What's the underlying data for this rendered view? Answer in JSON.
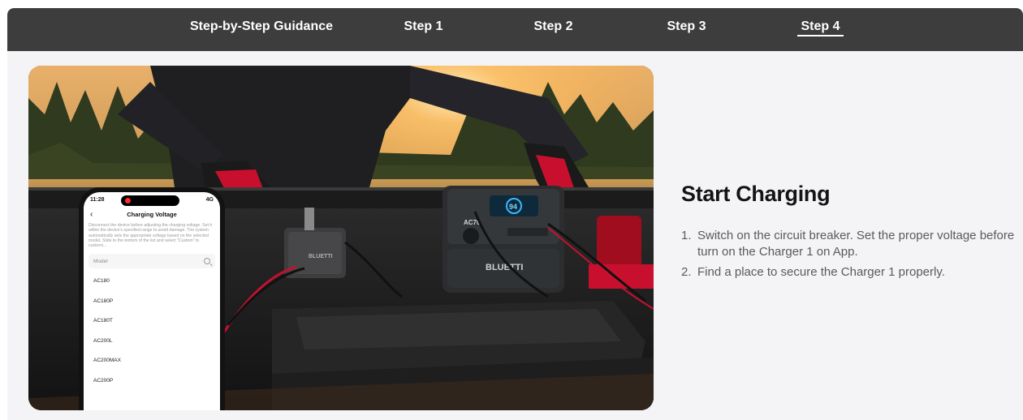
{
  "nav": {
    "items": [
      {
        "label": "Step-by-Step Guidance",
        "active": false
      },
      {
        "label": "Step 1",
        "active": false
      },
      {
        "label": "Step 2",
        "active": false
      },
      {
        "label": "Step 3",
        "active": false
      },
      {
        "label": "Step 4",
        "active": true
      }
    ]
  },
  "photo": {
    "brand_panel": "BLUETTI",
    "brand_station": "BLUETTI",
    "station_model": "AC70",
    "station_display": "94",
    "phone": {
      "time": "11:28",
      "network": "4G",
      "title": "Charging Voltage",
      "description": "Disconnect the device before adjusting the charging voltage. Set it within the device's specified range to avoid damage. The system automatically sets the appropriate voltage based on the selected model. Slide to the bottom of the list and select \"Custom\" to customi...",
      "search_placeholder": "Model",
      "models": [
        "AC180",
        "AC180P",
        "AC180T",
        "AC200L",
        "AC200MAX",
        "AC200P"
      ]
    }
  },
  "content": {
    "title": "Start Charging",
    "steps": [
      {
        "num": "1.",
        "text": "Switch on the circuit breaker. Set the proper voltage before turn on the Charger 1 on App."
      },
      {
        "num": "2.",
        "text": "Find a place to secure the Charger 1 properly."
      }
    ]
  },
  "colors": {
    "nav_bg": "#3d3d3e",
    "page_bg": "#f4f4f6",
    "heading": "#141414",
    "body_text": "#5a5a5c",
    "glove_red": "#c8102e"
  }
}
